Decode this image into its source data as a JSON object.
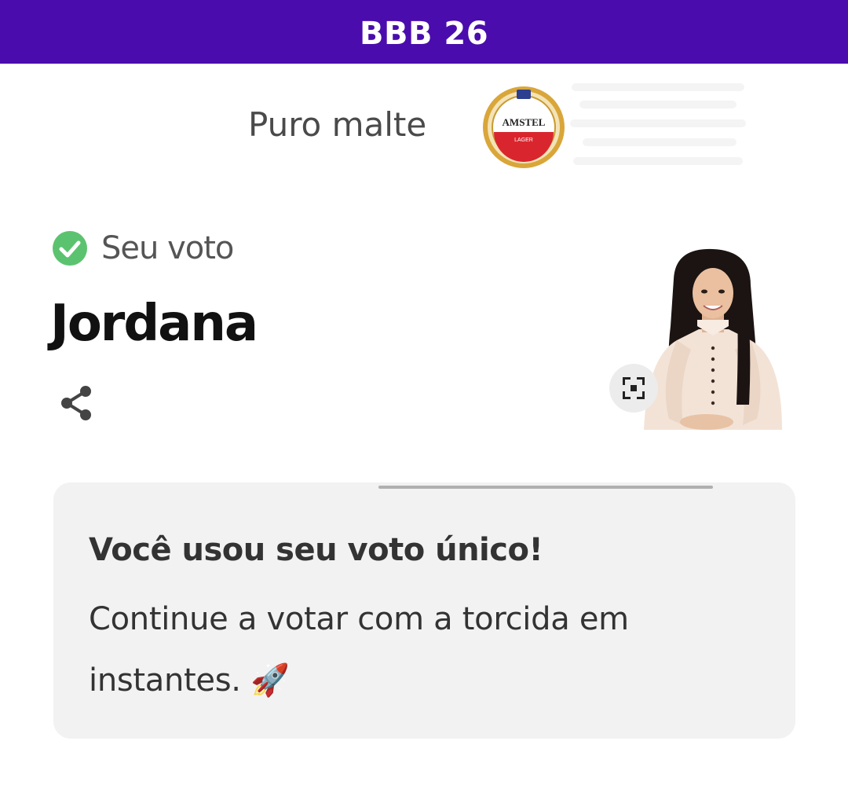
{
  "header": {
    "title": "BBB 26",
    "background_color": "#4a0cad"
  },
  "sponsor": {
    "tagline": "Puro malte",
    "logo_icon": "amstel-logo",
    "logo_text": "AMSTEL",
    "logo_subtext": "LAGER"
  },
  "vote": {
    "status_label": "Seu voto",
    "status_icon": "check-circle-icon",
    "status_color": "#5bc36f",
    "candidate_name": "Jordana",
    "share_icon": "share-icon",
    "expand_icon": "expand-icon"
  },
  "card": {
    "heading": "Você usou seu voto único!",
    "body": "Continue a votar com a torcida em instantes. 🚀"
  }
}
